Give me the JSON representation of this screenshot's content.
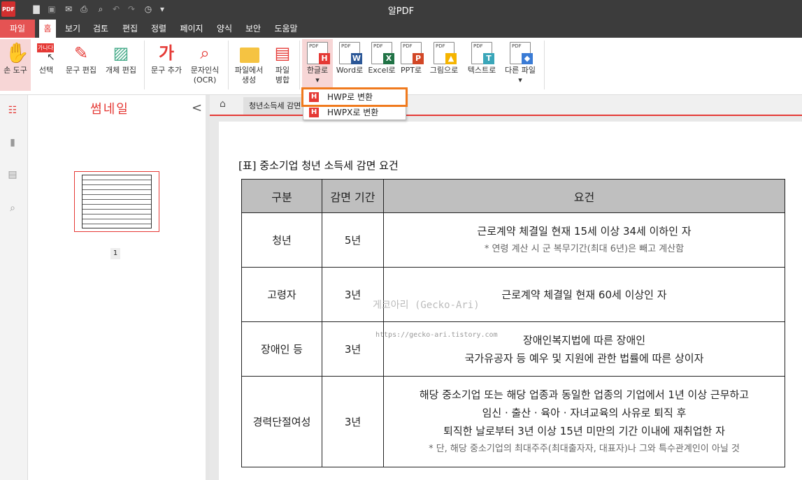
{
  "titlebar": {
    "logo": "PDF",
    "title": "알PDF"
  },
  "quick_access": {
    "icons": [
      "folder-icon",
      "save-icon",
      "mail-icon",
      "print-icon",
      "preview-icon",
      "undo-icon",
      "redo-icon",
      "history-icon",
      "more-icon"
    ]
  },
  "menu": {
    "tabs": [
      "파일",
      "홈",
      "보기",
      "검토",
      "편집",
      "정렬",
      "페이지",
      "양식",
      "보안",
      "도움말"
    ],
    "active": "홈"
  },
  "ribbon": {
    "hand_tool": "손 도구",
    "select": "선택",
    "select_badge": "가나다",
    "text_edit": "문구 편집",
    "object_edit": "개체 편집",
    "add_text": "문구 추가",
    "add_text_icon": "가",
    "ocr_line1": "문자인식",
    "ocr_line2": "(OCR)",
    "create_line1": "파일에서",
    "create_line2": "생성",
    "merge_line1": "파일",
    "merge_line2": "병합",
    "to_hangul": "한글로",
    "to_word": "Word로",
    "to_excel": "Excel로",
    "to_ppt": "PPT로",
    "to_image": "그림으로",
    "to_text": "텍스트로",
    "other_file": "다른 파일",
    "pdf_tag": "PDF",
    "badges": {
      "hwp": "H",
      "word": "W",
      "excel": "X",
      "ppt": "P",
      "text": "T"
    }
  },
  "dropdown": {
    "items": [
      "HWP로 변환",
      "HWPX로 변환"
    ],
    "icon": "H"
  },
  "thumbnail": {
    "title": "썸네일",
    "page_number": "1"
  },
  "doc_tab": {
    "label": "청년소득세 감면"
  },
  "document": {
    "caption": "[표] 중소기업 청년 소득세 감면 요건",
    "headers": [
      "구분",
      "감면 기간",
      "요건"
    ],
    "rows": [
      {
        "category": "청년",
        "period": "5년",
        "lines": [
          "근로계약 체결일 현재 15세 이상 34세 이하인 자"
        ],
        "note": "* 연령 계산 시 군 복무기간(최대 6년)은 빼고 계산함"
      },
      {
        "category": "고령자",
        "period": "3년",
        "lines": [
          "근로계약 체결일 현재 60세 이상인 자"
        ],
        "note": ""
      },
      {
        "category": "장애인 등",
        "period": "3년",
        "lines": [
          "장애인복지법에 따른 장애인",
          "국가유공자 등 예우 및 지원에 관한 법률에 따른 상이자"
        ],
        "note": ""
      },
      {
        "category": "경력단절여성",
        "period": "3년",
        "lines": [
          "해당 중소기업 또는 해당 업종과 동일한 업종의 기업에서 1년 이상 근무하고",
          "임신 · 출산 · 육아 · 자녀교육의 사유로 퇴직 후",
          "퇴직한 날로부터 3년 이상 15년 미만의 기간 이내에 재취업한 자"
        ],
        "note": "* 단, 해당 중소기업의 최대주주(최대출자자, 대표자)나 그와 특수관계인이 아닐 것"
      }
    ],
    "watermark": "게코아리 (Gecko-Ari)",
    "watermark_url": "https://gecko-ari.tistory.com"
  },
  "colors": {
    "accent": "#e53935",
    "highlight": "#f07a1e",
    "dark": "#3c3c3c"
  }
}
